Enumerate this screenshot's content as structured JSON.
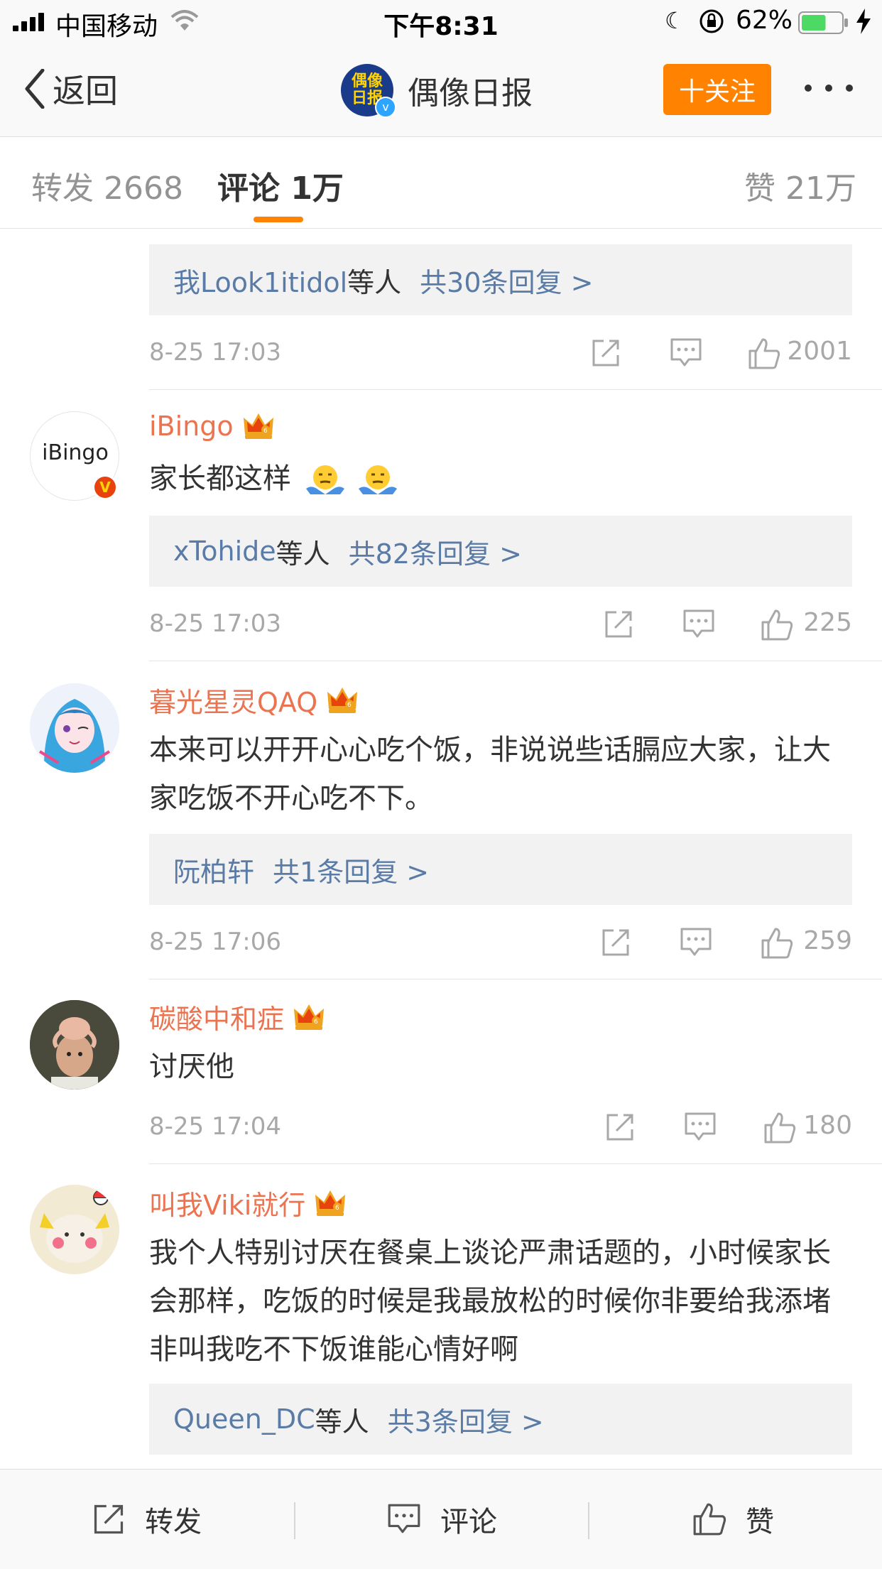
{
  "status_bar": {
    "carrier": "中国移动",
    "time": "下午8:31",
    "battery_percent": "62%",
    "battery_level": 0.62,
    "battery_color": "#4cd964"
  },
  "nav": {
    "back_label": "返回",
    "avatar_logo": "偶像日报",
    "title": "偶像日报",
    "follow_label": "十关注",
    "accent_color": "#ff8200"
  },
  "tabs": {
    "repost": "转发 2668",
    "comments": "评论 1万",
    "likes": "赞 21万",
    "active": "comments"
  },
  "comments": [
    {
      "reply_names": "我Look1itidol",
      "reply_etc": "等人",
      "reply_total": "共30条回复 >",
      "time": "8-25 17:03",
      "likes": "2001"
    },
    {
      "avatar_text": "iBingo",
      "username": "iBingo",
      "text": "家长都这样",
      "reply_names": "xTohide",
      "reply_etc": "等人",
      "reply_total": "共82条回复 >",
      "time": "8-25 17:03",
      "likes": "225"
    },
    {
      "username": "暮光星灵QAQ",
      "text": "本来可以开开心心吃个饭，非说说些话膈应大家，让大家吃饭不开心吃不下。",
      "reply_names": "阮柏轩",
      "reply_etc": "",
      "reply_total": "共1条回复 >",
      "time": "8-25 17:06",
      "likes": "259"
    },
    {
      "username": "碳酸中和症",
      "text": "讨厌他",
      "time": "8-25 17:04",
      "likes": "180"
    },
    {
      "username": "叫我Viki就行",
      "text": "我个人特别讨厌在餐桌上谈论严肃话题的，小时候家长会那样，吃饭的时候是我最放松的时候你非要给我添堵非叫我吃不下饭谁能心情好啊",
      "reply_names": "Queen_DC",
      "reply_etc": "等人",
      "reply_total": "共3条回复 >",
      "time": "",
      "likes": ""
    }
  ],
  "bottom_bar": {
    "repost": "转发",
    "comment": "评论",
    "like": "赞"
  },
  "colors": {
    "username": "#eb7350",
    "link": "#5a7ba6",
    "meta": "#a8a8a8"
  }
}
